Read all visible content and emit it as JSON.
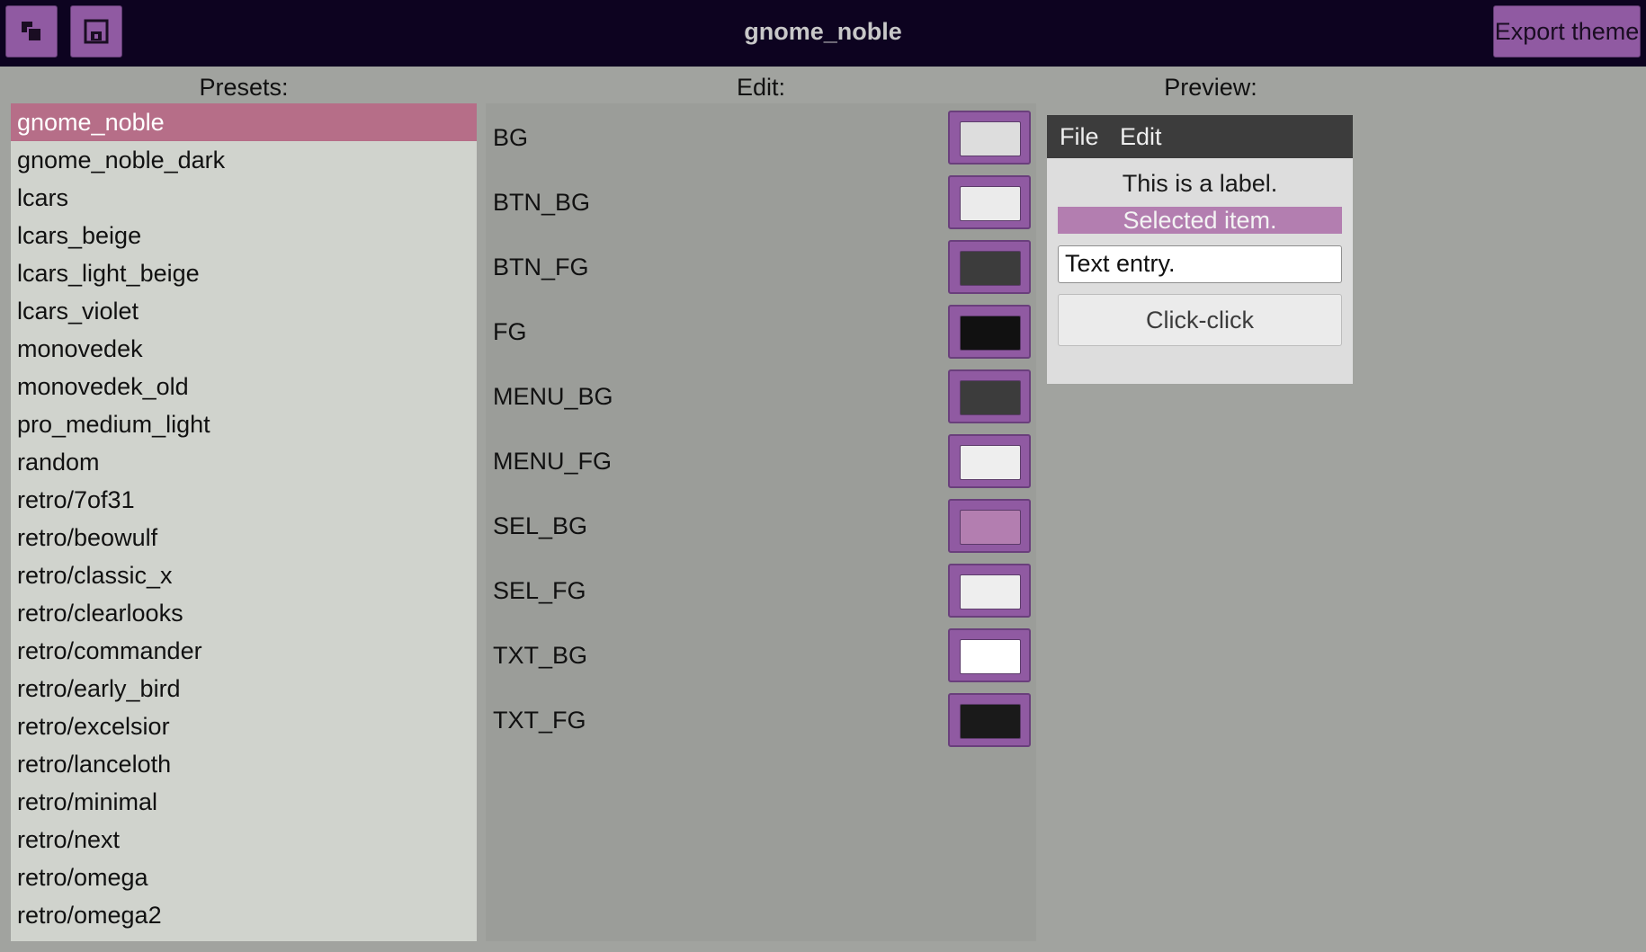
{
  "window": {
    "title": "gnome_noble",
    "export_label": "Export theme",
    "toolbar_icons": [
      "duplicate-icon",
      "save-icon"
    ]
  },
  "headers": {
    "presets": "Presets:",
    "edit": "Edit:",
    "preview": "Preview:"
  },
  "presets": {
    "selected": "gnome_noble",
    "items": [
      "gnome_noble",
      "gnome_noble_dark",
      "lcars",
      "lcars_beige",
      "lcars_light_beige",
      "lcars_violet",
      "monovedek",
      "monovedek_old",
      "pro_medium_light",
      "random",
      "retro/7of31",
      "retro/beowulf",
      "retro/classic_x",
      "retro/clearlooks",
      "retro/commander",
      "retro/early_bird",
      "retro/excelsior",
      "retro/lanceloth",
      "retro/minimal",
      "retro/next",
      "retro/omega",
      "retro/omega2"
    ]
  },
  "edit": {
    "rows": [
      {
        "label": "BG",
        "color": "#dddddd"
      },
      {
        "label": "BTN_BG",
        "color": "#ebebeb"
      },
      {
        "label": "BTN_FG",
        "color": "#3c3c3c"
      },
      {
        "label": "FG",
        "color": "#111111"
      },
      {
        "label": "MENU_BG",
        "color": "#3c3c3c"
      },
      {
        "label": "MENU_FG",
        "color": "#eeeeee"
      },
      {
        "label": "SEL_BG",
        "color": "#b37eb0"
      },
      {
        "label": "SEL_FG",
        "color": "#eeeeee"
      },
      {
        "label": "TXT_BG",
        "color": "#ffffff"
      },
      {
        "label": "TXT_FG",
        "color": "#1a1a1a"
      }
    ]
  },
  "preview": {
    "menu_file": "File",
    "menu_edit": "Edit",
    "label": "This is a label.",
    "selected_item": "Selected item.",
    "text_entry": "Text entry.",
    "button": "Click-click"
  },
  "colors": {
    "topbar_bg": "#0d0320",
    "accent": "#905aa2",
    "preset_selected_bg": "#b66e88",
    "app_bg": "#a1a39f"
  }
}
